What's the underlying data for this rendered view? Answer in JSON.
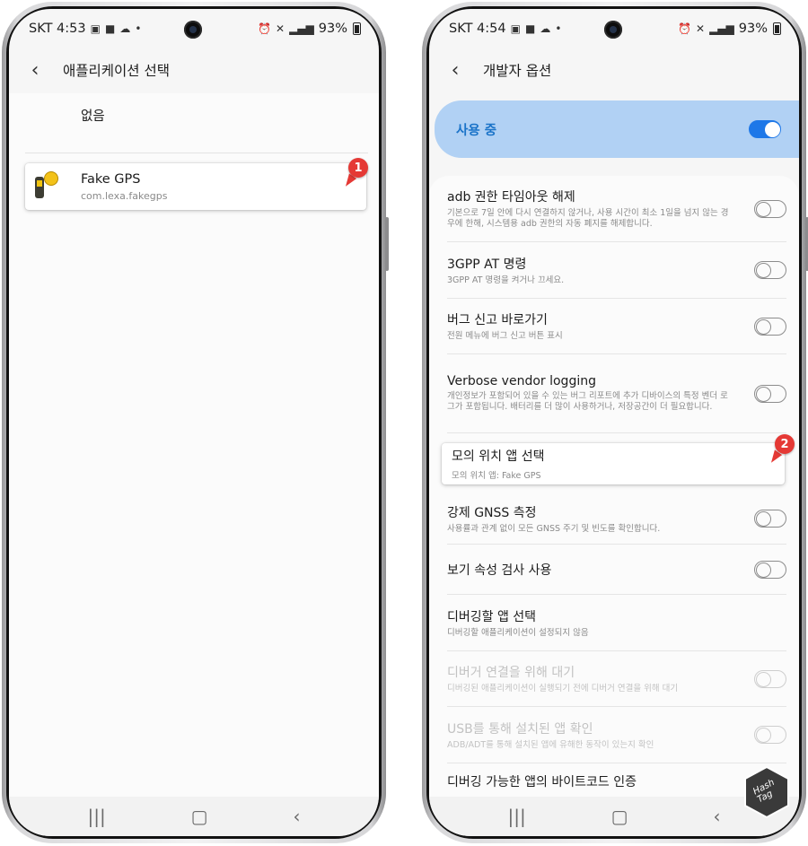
{
  "left_screen": {
    "status": {
      "carrier_time": "SKT 4:53",
      "battery": "93%"
    },
    "appbar": {
      "title": "애플리케이션 선택"
    },
    "none_label": "없음",
    "app": {
      "name": "Fake GPS",
      "package": "com.lexa.fakegps"
    },
    "marker": "1"
  },
  "right_screen": {
    "status": {
      "carrier_time": "SKT 4:54",
      "battery": "93%"
    },
    "appbar": {
      "title": "개발자 옵션"
    },
    "in_use": {
      "label": "사용 중",
      "enabled": true
    },
    "settings": [
      {
        "title": "adb 권한 타임아웃 해제",
        "summary": "기본으로 7일 안에 다시 연결하지 않거나, 사용 시간이 최소 1일을 넘지 않는 경우에 한해, 시스템용 adb 권한의 자동 폐지를 해제합니다."
      },
      {
        "title": "3GPP AT 명령",
        "summary": "3GPP AT 명령을 켜거나 끄세요."
      },
      {
        "title": "버그 신고 바로가기",
        "summary": "전원 메뉴에 버그 신고 버튼 표시"
      },
      {
        "title": "Verbose vendor logging",
        "summary": "개인정보가 포함되어 있을 수 있는 버그 리포트에 추가 디바이스의 특정 벤더 로그가 포함됩니다. 배터리를 더 많이 사용하거나, 저장공간이 더 필요합니다."
      },
      {
        "title": "모의 위치 앱 선택",
        "summary": "모의 위치 앱: Fake GPS"
      },
      {
        "title": "강제 GNSS 측정",
        "summary": "사용률과 관계 없이 모든 GNSS 주기 및 빈도를 확인합니다."
      },
      {
        "title": "보기 속성 검사 사용",
        "summary": ""
      },
      {
        "title": "디버깅할 앱 선택",
        "summary": "디버깅할 애플리케이션이 설정되지 않음"
      },
      {
        "title": "디버거 연결을 위해 대기",
        "summary": "디버깅된 애플리케이션이 실행되기 전에 디버거 연결을 위해 대기"
      },
      {
        "title": "USB를 통해 설치된 앱 확인",
        "summary": "ADB/ADT를 통해 설치된 앱에 유해한 동작이 있는지 확인"
      },
      {
        "title": "디버깅 가능한 앱의 바이트코드 인증",
        "summary": ""
      }
    ],
    "marker": "2"
  },
  "watermark": {
    "text": "Hash Tag"
  }
}
